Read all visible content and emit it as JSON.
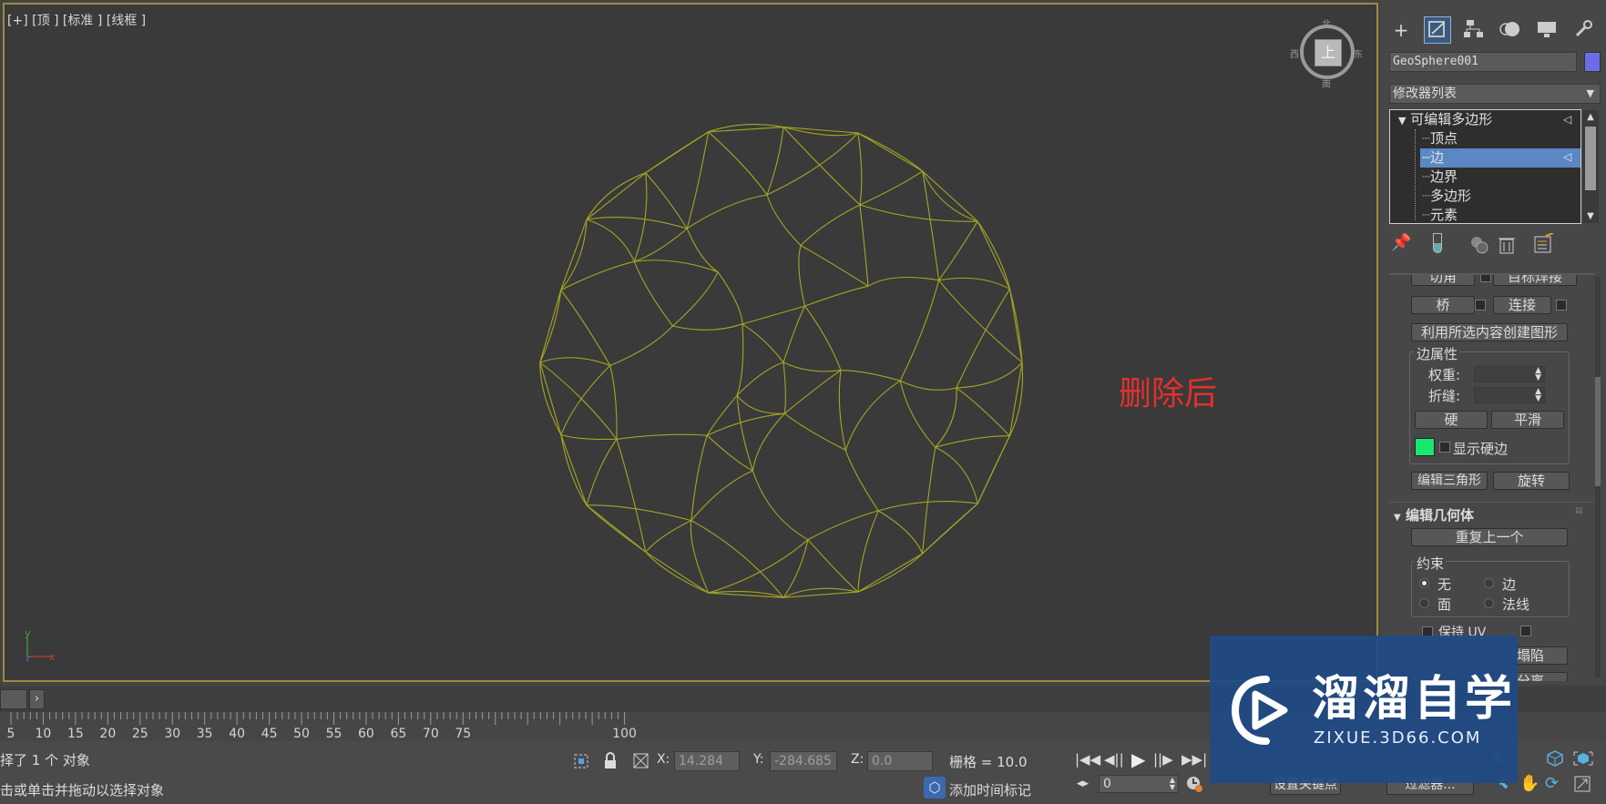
{
  "viewport": {
    "label": "[+] [顶 ] [标准 ] [线框 ]",
    "annotation": "删除后",
    "viewcube_face": "上",
    "viewcube_north": "北",
    "viewcube_south": "南",
    "viewcube_east": "东",
    "viewcube_west": "西",
    "axis_y": "y",
    "axis_x": "x",
    "axis_z": "z",
    "mesh_color": "#a3a624"
  },
  "command_panel": {
    "tabs": [
      "create-icon",
      "modify-icon",
      "hierarchy-icon",
      "motion-icon",
      "display-icon",
      "utilities-icon"
    ],
    "object_name": "GeoSphere001",
    "object_color": "#6c6ce6",
    "modifier_list": "修改器列表",
    "stack": {
      "root": "可编辑多边形",
      "items": [
        "顶点",
        "边",
        "边界",
        "多边形",
        "元素"
      ],
      "selected": "边"
    },
    "partial_row": {
      "left": "切角",
      "right": "目标焊接"
    },
    "bridge_label": "桥",
    "connect_label": "连接",
    "create_shape_label": "利用所选内容创建图形",
    "edge_properties": {
      "title": "边属性",
      "weight_label": "权重:",
      "crease_label": "折缝:",
      "hard_label": "硬",
      "smooth_label": "平滑",
      "show_hard_label": "显示硬边",
      "hard_color": "#18e870"
    },
    "edit_tri_label": "编辑三角形",
    "turn_label": "旋转",
    "edit_geometry": {
      "title": "编辑几何体",
      "repeat_label": "重复上一个",
      "constraints_title": "约束",
      "none": "无",
      "edge": "边",
      "face": "面",
      "normal": "法线",
      "preserve_uv": "保持 UV",
      "collapse": "塌陷",
      "detach": "分离"
    }
  },
  "timeline": {
    "ticks": [
      "5",
      "10",
      "15",
      "20",
      "25",
      "30",
      "35",
      "40",
      "45",
      "50",
      "55",
      "60",
      "65",
      "70",
      "75",
      "100"
    ]
  },
  "status": {
    "selected_text": "择了 1 个 对象",
    "prompt_text": "击或单击并拖动以选择对象",
    "x_label": "X:",
    "x_value": "14.284",
    "y_label": "Y:",
    "y_value": "-284.685",
    "z_label": "Z:",
    "z_value": "0.0",
    "grid_text": "栅格 = 10.0",
    "add_time_tag": "添加时间标记",
    "frame_value": "0",
    "set_key": "设置关键点",
    "filters": "过滤器..."
  },
  "watermark": {
    "brand": "溜溜自学",
    "url": "ZIXUE.3D66.COM"
  }
}
